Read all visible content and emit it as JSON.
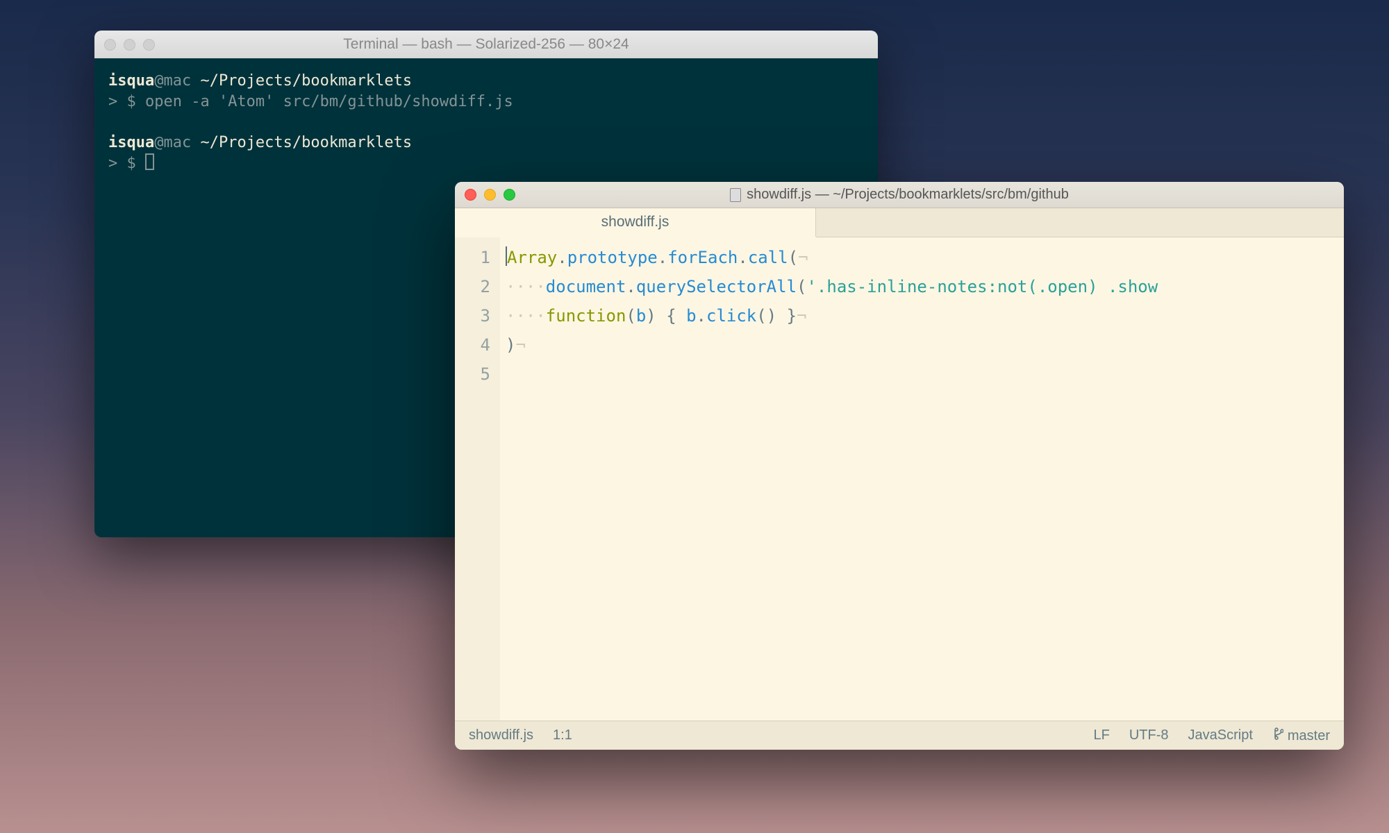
{
  "terminal": {
    "title": "Terminal — bash — Solarized-256 — 80×24",
    "lines": [
      {
        "user": "isqua",
        "host": "@mac",
        "path": " ~/Projects/bookmarklets"
      },
      {
        "prompt": "> $ ",
        "cmd": "open -a 'Atom' src/bm/github/showdiff.js"
      },
      {},
      {
        "user": "isqua",
        "host": "@mac",
        "path": " ~/Projects/bookmarklets"
      },
      {
        "prompt": "> $ ",
        "cursor": true
      }
    ]
  },
  "editor": {
    "title": "showdiff.js — ~/Projects/bookmarklets/src/bm/github",
    "tabs": [
      {
        "label": "showdiff.js",
        "active": true
      }
    ],
    "gutter": [
      "1",
      "2",
      "3",
      "4",
      "5"
    ],
    "code": {
      "line1": {
        "a": "Array",
        "b": ".",
        "c": "prototype",
        "d": ".",
        "e": "forEach",
        "f": ".",
        "g": "call",
        "h": "(",
        "nl": "¬"
      },
      "line2": {
        "ws": "····",
        "a": "document",
        "b": ".",
        "c": "querySelectorAll",
        "d": "(",
        "e": "'.has-inline-notes:not(.open) .show",
        "tail": ""
      },
      "line3": {
        "ws": "····",
        "kw": "function",
        "a": "(",
        "b": "b",
        "c": ") { ",
        "d": "b",
        "e": ".",
        "f": "click",
        "g": "() }",
        "nl": "¬"
      },
      "line4": {
        "a": ")",
        "nl": "¬"
      }
    },
    "status": {
      "filename": "showdiff.js",
      "position": "1:1",
      "line_ending": "LF",
      "encoding": "UTF-8",
      "language": "JavaScript",
      "branch": "master"
    }
  }
}
